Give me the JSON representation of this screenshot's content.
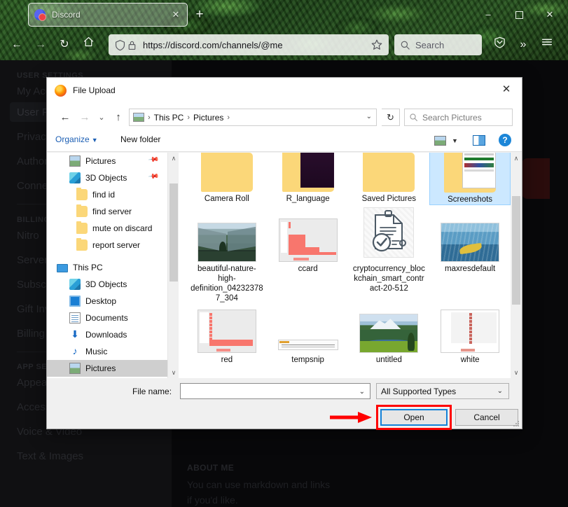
{
  "browser": {
    "tab": {
      "title": "Discord",
      "close_label": "✕",
      "favicon": "discord-favicon"
    },
    "new_tab_label": "+",
    "window_controls": {
      "minimize": "–",
      "maximize": "□",
      "close": "✕"
    },
    "nav": {
      "back": "←",
      "forward": "→",
      "reload": "↻",
      "home": "⌂"
    },
    "url": "https://discord.com/channels/@me",
    "search_placeholder": "Search",
    "overflow_label": "»"
  },
  "discord": {
    "sections": [
      {
        "header": "USER SETTINGS",
        "items": [
          "My Account",
          "User Profile",
          "Privacy & Safety",
          "Authorized Apps",
          "Connections"
        ]
      },
      {
        "header": "BILLING SETTINGS",
        "items": [
          "Nitro",
          "Server Boost",
          "Subscriptions",
          "Gift Inventory",
          "Billing"
        ]
      },
      {
        "header": "APP SETTINGS",
        "items": [
          "Appearance",
          "Accessibility",
          "Voice & Video",
          "Text & Images"
        ]
      }
    ],
    "selected_item": "User Profile",
    "about_me_header": "ABOUT ME",
    "about_me_lines": [
      "You can use markdown and links",
      "if you'd like."
    ]
  },
  "dialog": {
    "title": "File Upload",
    "close_label": "✕",
    "nav": {
      "back": "←",
      "forward": "→",
      "recent": "⌄",
      "up": "↑",
      "refresh": "↻"
    },
    "breadcrumb": [
      "This PC",
      "Pictures"
    ],
    "breadcrumb_separator": "›",
    "breadcrumb_dropdown": "⌄",
    "search_placeholder": "Search Pictures",
    "organize_label": "Organize",
    "organize_caret": "▼",
    "new_folder_label": "New folder",
    "view_caret": "▼",
    "help_label": "?",
    "scroll_up": "∧",
    "scroll_down": "∨",
    "sidebar": [
      {
        "label": "Pictures",
        "icon": "pictures-icon",
        "indent": 1,
        "pinned": true
      },
      {
        "label": "3D Objects",
        "icon": "3d-objects-icon",
        "indent": 1,
        "pinned": true
      },
      {
        "label": "find id",
        "icon": "folder-icon",
        "indent": 2,
        "pinned": false
      },
      {
        "label": "find server",
        "icon": "folder-icon",
        "indent": 2,
        "pinned": false
      },
      {
        "label": "mute on discard",
        "icon": "folder-icon",
        "indent": 2,
        "pinned": false
      },
      {
        "label": "report server",
        "icon": "folder-icon",
        "indent": 2,
        "pinned": false
      },
      {
        "label": "This PC",
        "icon": "this-pc-icon",
        "indent": 0,
        "pinned": false
      },
      {
        "label": "3D Objects",
        "icon": "3d-objects-icon",
        "indent": 1,
        "pinned": false
      },
      {
        "label": "Desktop",
        "icon": "desktop-icon",
        "indent": 1,
        "pinned": false
      },
      {
        "label": "Documents",
        "icon": "documents-icon",
        "indent": 1,
        "pinned": false
      },
      {
        "label": "Downloads",
        "icon": "downloads-icon",
        "indent": 1,
        "pinned": false
      },
      {
        "label": "Music",
        "icon": "music-icon",
        "indent": 1,
        "pinned": false
      },
      {
        "label": "Pictures",
        "icon": "pictures-icon",
        "indent": 1,
        "pinned": false,
        "selected": true
      }
    ],
    "files": [
      {
        "name": "Camera Roll",
        "type": "folder",
        "selected": false
      },
      {
        "name": "R_language",
        "type": "folder-dark",
        "selected": false
      },
      {
        "name": "Saved Pictures",
        "type": "folder",
        "selected": false
      },
      {
        "name": "Screenshots",
        "type": "folder-screenshots",
        "selected": true
      },
      {
        "name": "beautiful-nature-high-definition_042323787_304",
        "type": "image-mountain",
        "selected": false
      },
      {
        "name": "ccard",
        "type": "chart-bar",
        "selected": false
      },
      {
        "name": "cryptocurrency_blockchain_smart_contract-20-512",
        "type": "document-icon",
        "selected": false
      },
      {
        "name": "maxresdefault",
        "type": "image-water",
        "selected": false
      },
      {
        "name": "red",
        "type": "chart-red",
        "selected": false
      },
      {
        "name": "tempsnip",
        "type": "image-snip",
        "selected": false
      },
      {
        "name": "untitled",
        "type": "image-lake",
        "selected": false
      },
      {
        "name": "white",
        "type": "chart-white",
        "selected": false
      }
    ],
    "footer": {
      "filename_label": "File name:",
      "filename_value": "",
      "filename_caret": "⌄",
      "filetype_value": "All Supported Types",
      "filetype_caret": "⌄",
      "open_label": "Open",
      "cancel_label": "Cancel"
    }
  },
  "annotation": {
    "arrow_color": "#ff0000",
    "highlight_color": "#ff0000",
    "focus_color": "#1482d8",
    "target": "Open"
  }
}
